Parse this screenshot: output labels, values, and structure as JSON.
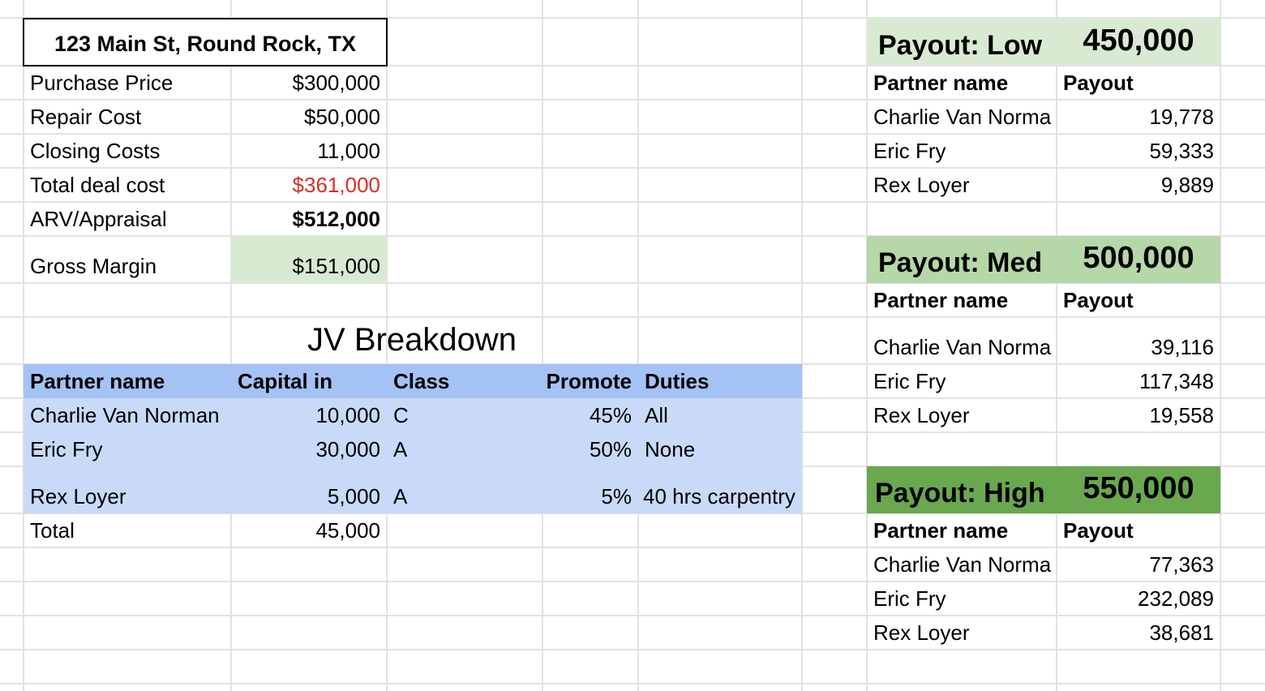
{
  "property": {
    "address": "123 Main St, Round Rock, TX",
    "rows": [
      {
        "label": "Purchase Price",
        "value": "$300,000"
      },
      {
        "label": "Repair Cost",
        "value": "$50,000"
      },
      {
        "label": "Closing Costs",
        "value": "11,000"
      },
      {
        "label": "Total deal cost",
        "value": "$361,000"
      },
      {
        "label": "ARV/Appraisal",
        "value": "$512,000"
      },
      {
        "label": "Gross Margin",
        "value": "$151,000"
      }
    ]
  },
  "jv": {
    "title": "JV Breakdown",
    "headers": [
      "Partner name",
      "Capital in",
      "Class",
      "Promote",
      "Duties"
    ],
    "rows": [
      {
        "name": "Charlie Van Norman",
        "capital": "10,000",
        "class": "C",
        "promote": "45%",
        "duties": "All"
      },
      {
        "name": "Eric Fry",
        "capital": "30,000",
        "class": "A",
        "promote": "50%",
        "duties": "None"
      },
      {
        "name": "Rex Loyer",
        "capital": "5,000",
        "class": "A",
        "promote": "5%",
        "duties": "40 hrs carpentry"
      }
    ],
    "total_label": "Total",
    "total_value": "45,000"
  },
  "payouts": [
    {
      "label": "Payout: Low",
      "amount": "450,000",
      "col_name": "Partner name",
      "col_payout": "Payout",
      "rows": [
        {
          "name": "Charlie Van Norma",
          "value": "19,778"
        },
        {
          "name": "Eric Fry",
          "value": "59,333"
        },
        {
          "name": "Rex Loyer",
          "value": "9,889"
        }
      ]
    },
    {
      "label": "Payout: Med",
      "amount": "500,000",
      "col_name": "Partner name",
      "col_payout": "Payout",
      "rows": [
        {
          "name": "Charlie Van Norma",
          "value": "39,116"
        },
        {
          "name": "Eric Fry",
          "value": "117,348"
        },
        {
          "name": "Rex Loyer",
          "value": "19,558"
        }
      ]
    },
    {
      "label": "Payout: High",
      "amount": "550,000",
      "col_name": "Partner name",
      "col_payout": "Payout",
      "rows": [
        {
          "name": "Charlie Van Norma",
          "value": "77,363"
        },
        {
          "name": "Eric Fry",
          "value": "232,089"
        },
        {
          "name": "Rex Loyer",
          "value": "38,681"
        }
      ]
    }
  ],
  "colors": {
    "gridline": "#e2e2e2",
    "negative_red": "#d93025",
    "light_green": "#d9ead3",
    "medium_green": "#b6d7a8",
    "dark_green": "#6aa84f",
    "header_blue": "#a4c2f4",
    "row_blue": "#c9daf8"
  }
}
